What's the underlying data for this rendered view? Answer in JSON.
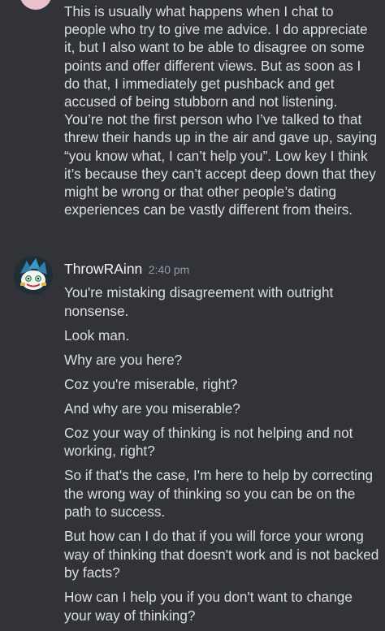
{
  "previous_message": {
    "text": "This is usually what happens when I chat to people who try to give me advice. I do appreciate it, but I also want to be able to disagree on some points and offer different views. But as soon as I do that, I immediately get pushback and get accused of being stubborn and not listening. You’re not the first person who I’ve talked to that threw their hands up in the air and gave up, saying “you know what, I can’t help you”. Low key I think it’s because they can’t accept deep down that they might be wrong or that other people’s dating experiences can be vastly different from theirs."
  },
  "message": {
    "username": "ThrowRAinn",
    "timestamp": "2:40 pm",
    "lines": [
      "You're mistaking disagreement with outright nonsense.",
      "Look man.",
      "Why are you here?",
      "Coz you're miserable, right?",
      "And why are you miserable?",
      "Coz your way of thinking is not helping and not working, right?",
      "So if that's the case, I'm here to help by correcting the wrong way of thinking so you can be on the path to success.",
      "But how can I do that if you will force your wrong way of thinking that doesn't work and is not backed by facts?",
      "How can I help you if you don't want to change your way of thinking?"
    ]
  },
  "colors": {
    "background": "#313338",
    "text": "#dbdee1",
    "username": "#f2f3f5",
    "timestamp": "#949ba4"
  }
}
